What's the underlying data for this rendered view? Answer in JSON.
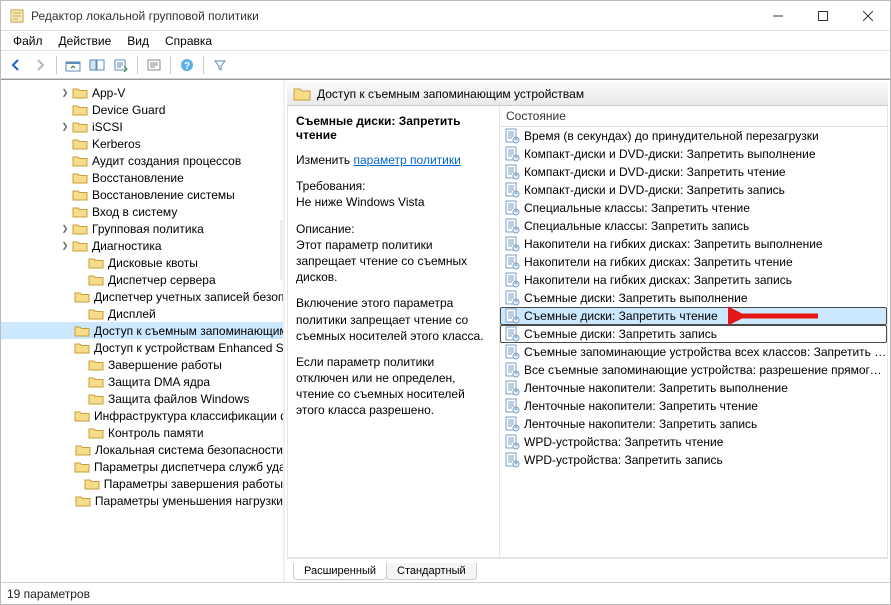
{
  "window": {
    "title": "Редактор локальной групповой политики"
  },
  "menu": {
    "file": "Файл",
    "action": "Действие",
    "view": "Вид",
    "help": "Справка"
  },
  "tree": {
    "items": [
      {
        "label": "App-V",
        "depth": 1,
        "expandable": true
      },
      {
        "label": "Device Guard",
        "depth": 1
      },
      {
        "label": "iSCSI",
        "depth": 1,
        "expandable": true
      },
      {
        "label": "Kerberos",
        "depth": 1
      },
      {
        "label": "Аудит создания процессов",
        "depth": 1
      },
      {
        "label": "Восстановление",
        "depth": 1
      },
      {
        "label": "Восстановление системы",
        "depth": 1
      },
      {
        "label": "Вход в систему",
        "depth": 1
      },
      {
        "label": "Групповая политика",
        "depth": 1,
        "expandable": true
      },
      {
        "label": "Диагностика",
        "depth": 1,
        "expandable": true
      },
      {
        "label": "Дисковые квоты",
        "depth": 2
      },
      {
        "label": "Диспетчер сервера",
        "depth": 2
      },
      {
        "label": "Диспетчер учетных записей безопасности",
        "depth": 2
      },
      {
        "label": "Дисплей",
        "depth": 2
      },
      {
        "label": "Доступ к съемным запоминающим устройствам",
        "depth": 2,
        "selected": true
      },
      {
        "label": "Доступ к устройствам Enhanced Storage",
        "depth": 2
      },
      {
        "label": "Завершение работы",
        "depth": 2
      },
      {
        "label": "Защита DMA ядра",
        "depth": 2
      },
      {
        "label": "Защита файлов Windows",
        "depth": 2
      },
      {
        "label": "Инфраструктура классификации файлов",
        "depth": 2
      },
      {
        "label": "Контроль памяти",
        "depth": 2
      },
      {
        "label": "Локальная система безопасности",
        "depth": 2
      },
      {
        "label": "Параметры диспетчера служб удаленных рабочих столов",
        "depth": 2
      },
      {
        "label": "Параметры завершения работы",
        "depth": 2
      },
      {
        "label": "Параметры уменьшения нагрузки",
        "depth": 2
      }
    ]
  },
  "rightHeader": "Доступ к съемным запоминающим устройствам",
  "detail": {
    "title": "Съемные диски: Запретить чтение",
    "editLabel": "Изменить",
    "editLink": "параметр политики",
    "reqLabel": "Требования:",
    "reqText": "Не ниже Windows Vista",
    "descLabel": "Описание:",
    "desc1": "Этот параметр политики запрещает чтение со съемных дисков.",
    "desc2": "Включение этого параметра политики запрещает чтение со съемных носителей этого класса.",
    "desc3": "Если параметр политики отключен или не определен, чтение со съемных носителей этого класса разрешено."
  },
  "listHeader": {
    "state": "Состояние"
  },
  "policies": [
    {
      "label": "Время (в секундах) до принудительной перезагрузки"
    },
    {
      "label": "Компакт-диски и DVD-диски: Запретить выполнение"
    },
    {
      "label": "Компакт-диски и DVD-диски: Запретить чтение"
    },
    {
      "label": "Компакт-диски и DVD-диски: Запретить запись"
    },
    {
      "label": "Специальные классы: Запретить чтение"
    },
    {
      "label": "Специальные классы: Запретить запись"
    },
    {
      "label": "Накопители на гибких дисках: Запретить выполнение"
    },
    {
      "label": "Накопители на гибких дисках: Запретить чтение"
    },
    {
      "label": "Накопители на гибких дисках: Запретить запись"
    },
    {
      "label": "Съемные диски: Запретить выполнение"
    },
    {
      "label": "Съемные диски: Запретить чтение",
      "selected": true,
      "boxed": true
    },
    {
      "label": "Съемные диски: Запретить запись",
      "boxed": true
    },
    {
      "label": "Съемные запоминающие устройства всех классов: Запретить весь доступ"
    },
    {
      "label": "Все съемные запоминающие устройства: разрешение прямого доступа в удаленных сеансах"
    },
    {
      "label": "Ленточные накопители: Запретить выполнение"
    },
    {
      "label": "Ленточные накопители: Запретить чтение"
    },
    {
      "label": "Ленточные накопители: Запретить запись"
    },
    {
      "label": "WPD-устройства: Запретить чтение"
    },
    {
      "label": "WPD-устройства: Запретить запись"
    }
  ],
  "tabs": {
    "extended": "Расширенный",
    "standard": "Стандартный"
  },
  "status": "19 параметров"
}
